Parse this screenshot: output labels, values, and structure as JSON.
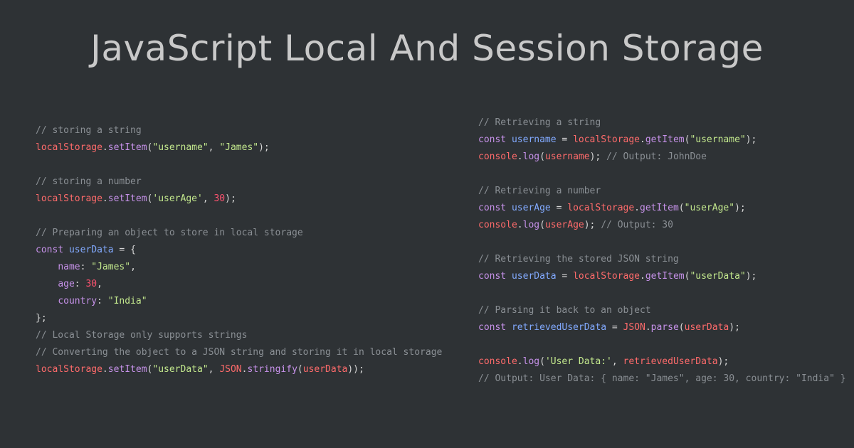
{
  "title": "JavaScript Local And Session Storage",
  "left_code": [
    [
      {
        "t": "// storing a string",
        "c": "cm"
      }
    ],
    [
      {
        "t": "localStorage",
        "c": "obj"
      },
      {
        "t": ".",
        "c": "p"
      },
      {
        "t": "setItem",
        "c": "meth"
      },
      {
        "t": "(",
        "c": "p"
      },
      {
        "t": "\"username\"",
        "c": "str"
      },
      {
        "t": ", ",
        "c": "p"
      },
      {
        "t": "\"James\"",
        "c": "str"
      },
      {
        "t": ");",
        "c": "p"
      }
    ],
    [],
    [
      {
        "t": "// storing a number",
        "c": "cm"
      }
    ],
    [
      {
        "t": "localStorage",
        "c": "obj"
      },
      {
        "t": ".",
        "c": "p"
      },
      {
        "t": "setItem",
        "c": "meth"
      },
      {
        "t": "(",
        "c": "p"
      },
      {
        "t": "'userAge'",
        "c": "str"
      },
      {
        "t": ", ",
        "c": "p"
      },
      {
        "t": "30",
        "c": "num"
      },
      {
        "t": ");",
        "c": "p"
      }
    ],
    [],
    [
      {
        "t": "// Preparing an object to store in local storage",
        "c": "cm"
      }
    ],
    [
      {
        "t": "const ",
        "c": "kw"
      },
      {
        "t": "userData",
        "c": "var"
      },
      {
        "t": " = {",
        "c": "p"
      }
    ],
    [
      {
        "t": "    ",
        "c": "p"
      },
      {
        "t": "name",
        "c": "prop"
      },
      {
        "t": ": ",
        "c": "p"
      },
      {
        "t": "\"James\"",
        "c": "str"
      },
      {
        "t": ",",
        "c": "p"
      }
    ],
    [
      {
        "t": "    ",
        "c": "p"
      },
      {
        "t": "age",
        "c": "prop"
      },
      {
        "t": ": ",
        "c": "p"
      },
      {
        "t": "30",
        "c": "num"
      },
      {
        "t": ",",
        "c": "p"
      }
    ],
    [
      {
        "t": "    ",
        "c": "p"
      },
      {
        "t": "country",
        "c": "prop"
      },
      {
        "t": ": ",
        "c": "p"
      },
      {
        "t": "\"India\"",
        "c": "str"
      }
    ],
    [
      {
        "t": "};",
        "c": "p"
      }
    ],
    [
      {
        "t": "// Local Storage only supports strings",
        "c": "cm"
      }
    ],
    [
      {
        "t": "// Converting the object to a JSON string and storing it in local storage",
        "c": "cm"
      }
    ],
    [
      {
        "t": "localStorage",
        "c": "obj"
      },
      {
        "t": ".",
        "c": "p"
      },
      {
        "t": "setItem",
        "c": "meth"
      },
      {
        "t": "(",
        "c": "p"
      },
      {
        "t": "\"userData\"",
        "c": "str"
      },
      {
        "t": ", ",
        "c": "p"
      },
      {
        "t": "JSON",
        "c": "obj"
      },
      {
        "t": ".",
        "c": "p"
      },
      {
        "t": "stringify",
        "c": "meth"
      },
      {
        "t": "(",
        "c": "p"
      },
      {
        "t": "userData",
        "c": "obj"
      },
      {
        "t": "));",
        "c": "p"
      }
    ]
  ],
  "right_code": [
    [
      {
        "t": "// Retrieving a string",
        "c": "cm"
      }
    ],
    [
      {
        "t": "const ",
        "c": "kw"
      },
      {
        "t": "username",
        "c": "var"
      },
      {
        "t": " = ",
        "c": "p"
      },
      {
        "t": "localStorage",
        "c": "obj"
      },
      {
        "t": ".",
        "c": "p"
      },
      {
        "t": "getItem",
        "c": "meth"
      },
      {
        "t": "(",
        "c": "p"
      },
      {
        "t": "\"username\"",
        "c": "str"
      },
      {
        "t": ");",
        "c": "p"
      }
    ],
    [
      {
        "t": "console",
        "c": "obj"
      },
      {
        "t": ".",
        "c": "p"
      },
      {
        "t": "log",
        "c": "meth"
      },
      {
        "t": "(",
        "c": "p"
      },
      {
        "t": "username",
        "c": "obj"
      },
      {
        "t": "); ",
        "c": "p"
      },
      {
        "t": "// Output: JohnDoe",
        "c": "cm"
      }
    ],
    [],
    [
      {
        "t": "// Retrieving a number",
        "c": "cm"
      }
    ],
    [
      {
        "t": "const ",
        "c": "kw"
      },
      {
        "t": "userAge",
        "c": "var"
      },
      {
        "t": " = ",
        "c": "p"
      },
      {
        "t": "localStorage",
        "c": "obj"
      },
      {
        "t": ".",
        "c": "p"
      },
      {
        "t": "getItem",
        "c": "meth"
      },
      {
        "t": "(",
        "c": "p"
      },
      {
        "t": "\"userAge\"",
        "c": "str"
      },
      {
        "t": ");",
        "c": "p"
      }
    ],
    [
      {
        "t": "console",
        "c": "obj"
      },
      {
        "t": ".",
        "c": "p"
      },
      {
        "t": "log",
        "c": "meth"
      },
      {
        "t": "(",
        "c": "p"
      },
      {
        "t": "userAge",
        "c": "obj"
      },
      {
        "t": "); ",
        "c": "p"
      },
      {
        "t": "// Output: 30",
        "c": "cm"
      }
    ],
    [],
    [
      {
        "t": "// Retrieving the stored JSON string",
        "c": "cm"
      }
    ],
    [
      {
        "t": "const ",
        "c": "kw"
      },
      {
        "t": "userData",
        "c": "var"
      },
      {
        "t": " = ",
        "c": "p"
      },
      {
        "t": "localStorage",
        "c": "obj"
      },
      {
        "t": ".",
        "c": "p"
      },
      {
        "t": "getItem",
        "c": "meth"
      },
      {
        "t": "(",
        "c": "p"
      },
      {
        "t": "\"userData\"",
        "c": "str"
      },
      {
        "t": ");",
        "c": "p"
      }
    ],
    [],
    [
      {
        "t": "// Parsing it back to an object",
        "c": "cm"
      }
    ],
    [
      {
        "t": "const ",
        "c": "kw"
      },
      {
        "t": "retrievedUserData",
        "c": "var"
      },
      {
        "t": " = ",
        "c": "p"
      },
      {
        "t": "JSON",
        "c": "obj"
      },
      {
        "t": ".",
        "c": "p"
      },
      {
        "t": "parse",
        "c": "meth"
      },
      {
        "t": "(",
        "c": "p"
      },
      {
        "t": "userData",
        "c": "obj"
      },
      {
        "t": ");",
        "c": "p"
      }
    ],
    [],
    [
      {
        "t": "console",
        "c": "obj"
      },
      {
        "t": ".",
        "c": "p"
      },
      {
        "t": "log",
        "c": "meth"
      },
      {
        "t": "(",
        "c": "p"
      },
      {
        "t": "'User Data:'",
        "c": "str"
      },
      {
        "t": ", ",
        "c": "p"
      },
      {
        "t": "retrievedUserData",
        "c": "obj"
      },
      {
        "t": ");",
        "c": "p"
      }
    ],
    [
      {
        "t": "// Output: User Data: { name: \"James\", age: 30, country: \"India\" }",
        "c": "cm"
      }
    ]
  ]
}
